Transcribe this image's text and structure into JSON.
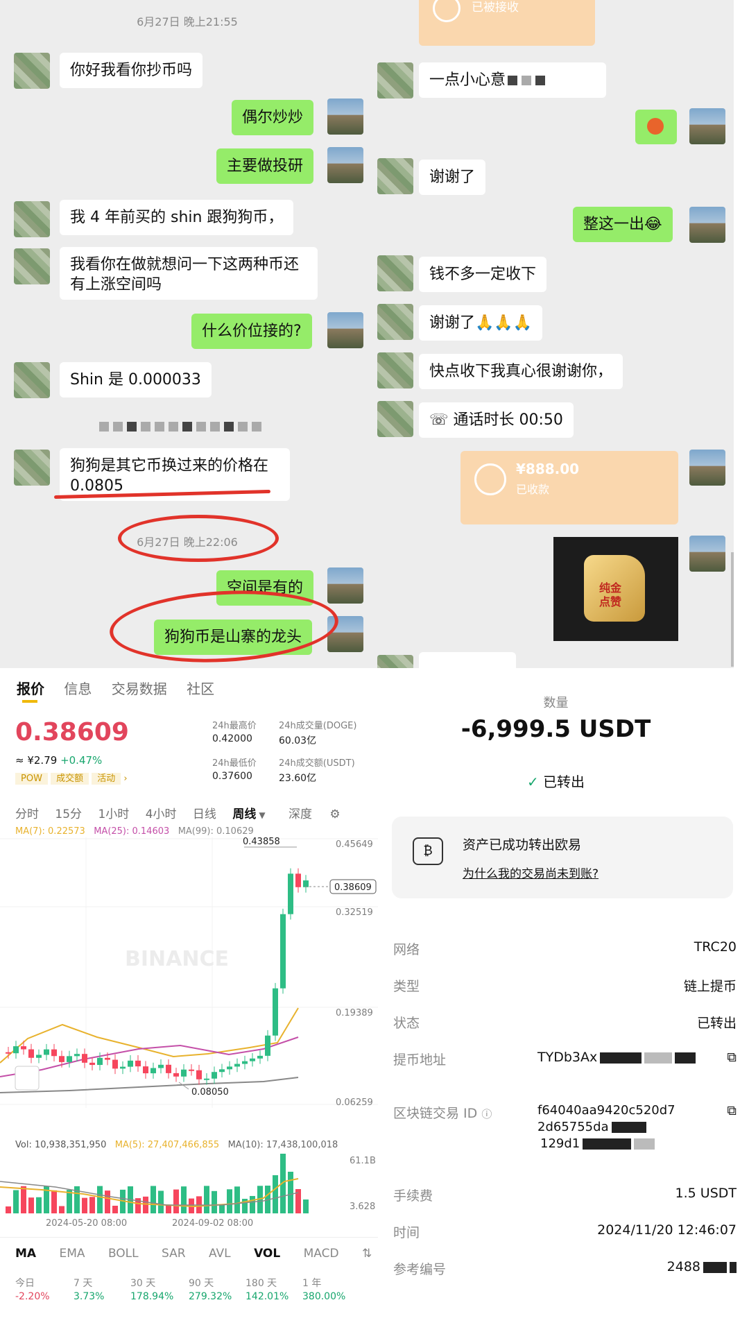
{
  "chat_left": {
    "time1": "6月27日 晚上21:55",
    "time2": "6月27日 晚上22:06",
    "messages": [
      {
        "text": "你好我看你抄币吗"
      },
      {
        "text": "偶尔炒炒"
      },
      {
        "text": "主要做投研"
      },
      {
        "text": "我 4 年前买的 shin 跟狗狗币，"
      },
      {
        "text": "我看你在做就想问一下这两种币还"
      },
      {
        "text": "有上涨空间吗"
      },
      {
        "text": "什么价位接的?"
      },
      {
        "text": "Shin 是 0.000033"
      },
      {
        "text": "狗狗是其它币换过来的价格在"
      },
      {
        "text": "0.0805"
      },
      {
        "text": "空间是有的"
      },
      {
        "text": "狗狗币是山寨的龙头"
      }
    ]
  },
  "chat_right": {
    "top_transfer_status": "已被接收",
    "messages": [
      {
        "text": "一点小心意"
      },
      {
        "text": "谢谢了"
      },
      {
        "text": "整这一出😂"
      },
      {
        "text": "钱不多一定收下"
      },
      {
        "text": "谢谢了🙏🙏🙏"
      },
      {
        "text": "快点收下我真心很谢谢你，"
      },
      {
        "text": "通话时长 00:50"
      }
    ],
    "transfer": {
      "amount": "¥888.00",
      "status": "已收款"
    },
    "sticker_text": [
      "纯金",
      "点赞"
    ]
  },
  "binance": {
    "tabs": [
      "报价",
      "信息",
      "交易数据",
      "社区"
    ],
    "price": "0.38609",
    "cny": "≈ ¥2.79",
    "change": "+0.47%",
    "tags": [
      "POW",
      "成交额",
      "活动"
    ],
    "stats": [
      {
        "label": "24h最高价",
        "value": "0.42000"
      },
      {
        "label": "24h成交量(DOGE)",
        "value": "60.03亿"
      },
      {
        "label": "24h最低价",
        "value": "0.37600"
      },
      {
        "label": "24h成交额(USDT)",
        "value": "23.60亿"
      }
    ],
    "intervals": [
      "分时",
      "15分",
      "1小时",
      "4小时",
      "日线",
      "周线",
      "深度"
    ],
    "ma_line": {
      "ma7": "MA(7): 0.22573",
      "ma25": "MA(25): 0.14603",
      "ma99": "MA(99): 0.10629"
    },
    "axis": [
      "0.45649",
      "0.32519",
      "0.19389",
      "0.06259"
    ],
    "high_label": "0.43858",
    "low_label": "0.08050",
    "current_tag": "0.38609",
    "watermark": "BINANCE",
    "vol_line": {
      "vol": "Vol: 10,938,351,950",
      "ma5": "MA(5): 27,407,466,855",
      "ma10": "MA(10): 17,438,100,018"
    },
    "vol_axis": [
      "61.1B",
      "3.628"
    ],
    "dates": [
      "2024-05-20 08:00",
      "2024-09-02 08:00"
    ],
    "indicators": [
      "MA",
      "EMA",
      "BOLL",
      "SAR",
      "AVL",
      "VOL",
      "MACD"
    ],
    "perf": [
      {
        "label": "今日",
        "value": "-2.20%"
      },
      {
        "label": "7 天",
        "value": "3.73%"
      },
      {
        "label": "30 天",
        "value": "178.94%"
      },
      {
        "label": "90 天",
        "value": "279.32%"
      },
      {
        "label": "180 天",
        "value": "142.01%"
      },
      {
        "label": "1 年",
        "value": "380.00%"
      }
    ]
  },
  "withdraw": {
    "qty_label": "数量",
    "amount": "-6,999.5 USDT",
    "status": "已转出",
    "notice": "资产已成功转出欧易",
    "help_link": "为什么我的交易尚未到账?",
    "rows": [
      {
        "k": "网络",
        "v": "TRC20"
      },
      {
        "k": "类型",
        "v": "链上提币"
      },
      {
        "k": "状态",
        "v": "已转出"
      },
      {
        "k": "提币地址",
        "v": "TYDb3Ax"
      },
      {
        "k": "区块链交易 ID",
        "v": "f64040aa9420c520d7"
      },
      {
        "k": "",
        "v": "2d65755da"
      },
      {
        "k": "",
        "v": "129d1"
      },
      {
        "k": "手续费",
        "v": "1.5 USDT"
      },
      {
        "k": "时间",
        "v": "2024/11/20 12:46:07"
      },
      {
        "k": "参考编号",
        "v": "2488"
      }
    ]
  },
  "chart_data": {
    "type": "candlestick",
    "ylim": [
      0.06259,
      0.45649
    ],
    "x": [
      "2024-05-20 08:00",
      "2024-09-02 08:00"
    ],
    "high": 0.43858,
    "low": 0.0805,
    "last": 0.38609
  }
}
